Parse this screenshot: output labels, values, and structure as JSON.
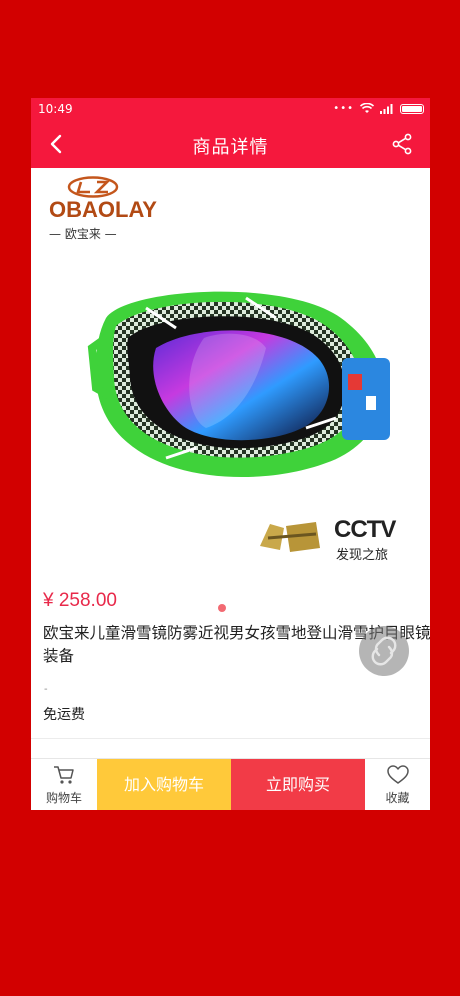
{
  "status": {
    "time": "10:49",
    "dots": "•••"
  },
  "navbar": {
    "title": "商品详情",
    "back_icon": "chevron-left-icon",
    "share_icon": "share-icon"
  },
  "gallery": {
    "brand": "OBAOLAY",
    "brand_sub": "— 欧宝来 —",
    "badge_text": "CCTV",
    "badge_sub": "发现之旅",
    "page_count": 1,
    "active_page": 1
  },
  "product": {
    "price": "¥ 258.00",
    "name": "欧宝来儿童滑雪镜防雾近视男女孩雪地登山滑雪护目眼镜装备",
    "dash": "-",
    "shipping": "免运费"
  },
  "bottom": {
    "cart_label": "购物车",
    "add_cart_label": "加入购物车",
    "buy_label": "立即购买",
    "fav_label": "收藏"
  },
  "colors": {
    "header": "#f5183d",
    "price": "#e8294a",
    "add_cart": "#ffc93a",
    "buy_now": "#f23b47",
    "background": "#d20000"
  }
}
